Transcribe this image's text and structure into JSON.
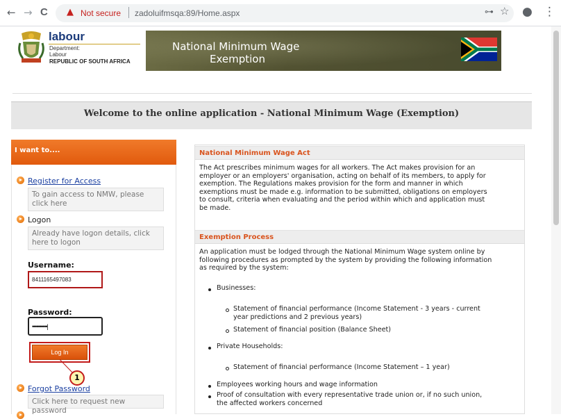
{
  "browser": {
    "not_secure": "Not secure",
    "url": "zadoluifmsqa:89/Home.aspx",
    "back": "←",
    "forward": "→",
    "reload": "C",
    "warning_glyph": "▲",
    "key_glyph": "⊶",
    "star_glyph": "☆",
    "account_glyph": "●",
    "menu_glyph": "⋮"
  },
  "header": {
    "logo_labour": "labour",
    "logo_department": "Department:",
    "logo_labour_small": "Labour",
    "logo_republic": "REPUBLIC OF SOUTH AFRICA",
    "banner_line1": "National Minimum Wage",
    "banner_line2": "Exemption"
  },
  "welcome": "Welcome to the online application - National Minimum Wage (Exemption)",
  "sidebar": {
    "title": "I want to....",
    "register_link": "Register for Access",
    "register_hint": "To gain access to NMW, please click here",
    "logon_label": "Logon",
    "logon_hint": "Already have logon details, click here to logon",
    "username_label": "Username:",
    "username_value": "8411165497083",
    "password_label": "Password:",
    "password_value": "••••••••••|",
    "login_button": "Log In",
    "callout_number": "1",
    "forgot_link": "Forgot Password",
    "forgot_hint": "Click here to request new password"
  },
  "main": {
    "act_title": "National Minimum Wage Act",
    "act_lines": [
      "The Act prescribes minimum wages for all workers. The Act makes provision for an",
      "employer or an employers' organisation, acting on behalf of its members, to apply for",
      "exemption. The Regulations makes provision for the form and manner in which",
      "exemptions must be made e.g. information to be submitted, obligations on employers",
      "to consult, criteria when evaluating and the period within which and application must",
      "be made."
    ],
    "process_title": "Exemption Process",
    "process_lines": [
      "An application must be lodged through the National Minimum Wage system online by",
      "following procedures as prompted by the system by providing the following information",
      "as required by the system:"
    ],
    "businesses": "Businesses:",
    "business_item1_line1": "Statement of financial performance (Income Statement - 3 years - current",
    "business_item1_line2": "year predictions and 2 previous years)",
    "business_item2": "Statement of financial position (Balance Sheet)",
    "households": "Private Households:",
    "household_item1": "Statement of financial performance (Income Statement – 1 year)",
    "employees_item": "Employees working hours and wage information",
    "consult_line1": "Proof of consultation with every representative trade union or, if no such union,",
    "consult_line2": "the affected workers concerned"
  },
  "colors": {
    "accent_orange": "#e15a0d",
    "heading_orange": "#d9541e",
    "link_blue": "#1a3fa0",
    "highlight_red": "#c21a1a"
  }
}
